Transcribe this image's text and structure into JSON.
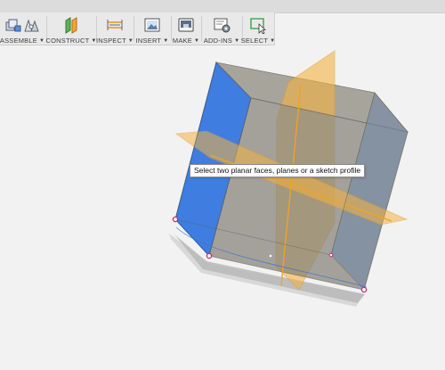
{
  "toolbar": {
    "groups": [
      {
        "label": "ASSEMBLE"
      },
      {
        "label": "CONSTRUCT"
      },
      {
        "label": "INSPECT"
      },
      {
        "label": "INSERT"
      },
      {
        "label": "MAKE"
      },
      {
        "label": "ADD-INS"
      },
      {
        "label": "SELECT"
      }
    ]
  },
  "viewport": {
    "tooltip": "Select two planar faces, planes or a sketch profile"
  },
  "colors": {
    "face_blue": "#3f7ee0",
    "plane_orange": "#f5b342",
    "body_gray": "#8e8c86",
    "vertex_magenta": "#c8286e"
  }
}
